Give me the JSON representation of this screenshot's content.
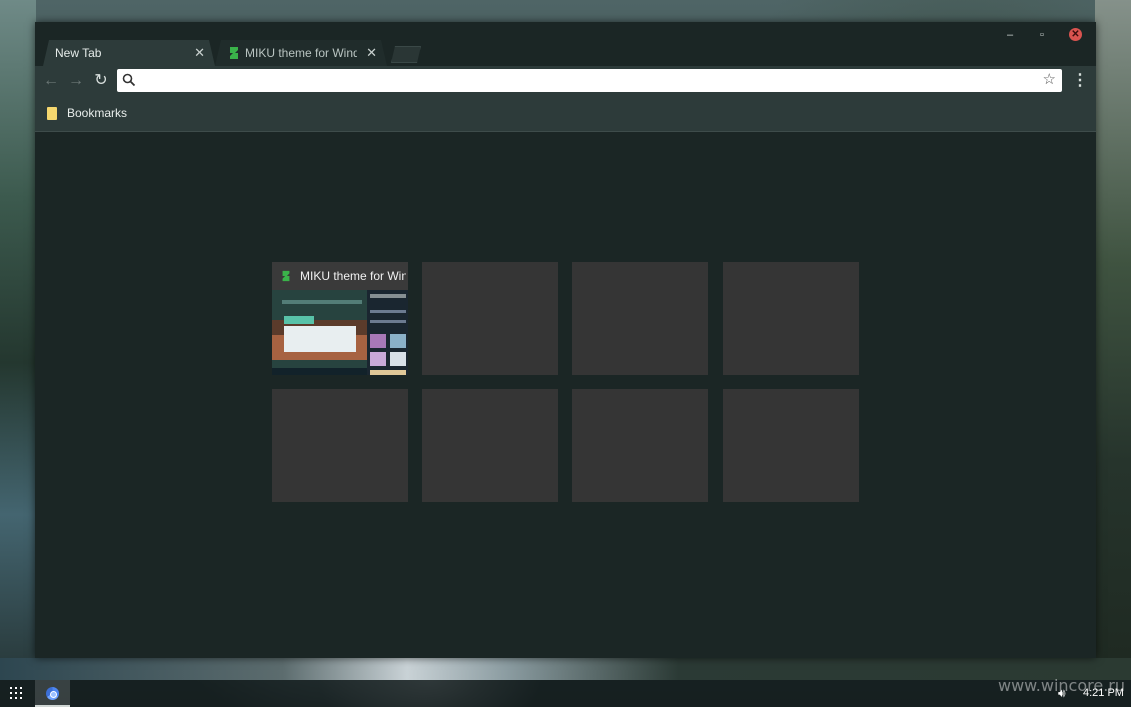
{
  "browser": {
    "tabs": [
      {
        "label": "New Tab",
        "active": true
      },
      {
        "label": "MIKU theme for Windows",
        "active": false
      }
    ],
    "window_controls": {
      "minimize": "–",
      "maximize": "▫",
      "close": "✕"
    },
    "omnibox": {
      "value": "",
      "placeholder": ""
    },
    "bookmarks_bar": {
      "items": [
        {
          "label": "Bookmarks"
        }
      ]
    }
  },
  "new_tab_page": {
    "tiles": [
      {
        "title": "MIKU theme for Windows",
        "filled": true
      },
      {
        "title": "",
        "filled": false
      },
      {
        "title": "",
        "filled": false
      },
      {
        "title": "",
        "filled": false
      },
      {
        "title": "",
        "filled": false
      },
      {
        "title": "",
        "filled": false
      },
      {
        "title": "",
        "filled": false
      },
      {
        "title": "",
        "filled": false
      }
    ]
  },
  "taskbar": {
    "clock": "4:21 PM"
  },
  "watermark": "www.wincore.ru",
  "colors": {
    "accent_favicon": "#3ab34a",
    "toolbar_bg": "#2d3b3a",
    "window_bg": "#1b2625",
    "tile_bg": "#353535"
  },
  "icons": {
    "back": "arrow-left-icon",
    "forward": "arrow-right-icon",
    "reload": "reload-icon",
    "search": "search-icon",
    "star": "star-icon",
    "menu": "menu-dots-icon",
    "folder": "folder-icon",
    "launcher": "apps-grid-icon",
    "volume": "volume-icon"
  }
}
